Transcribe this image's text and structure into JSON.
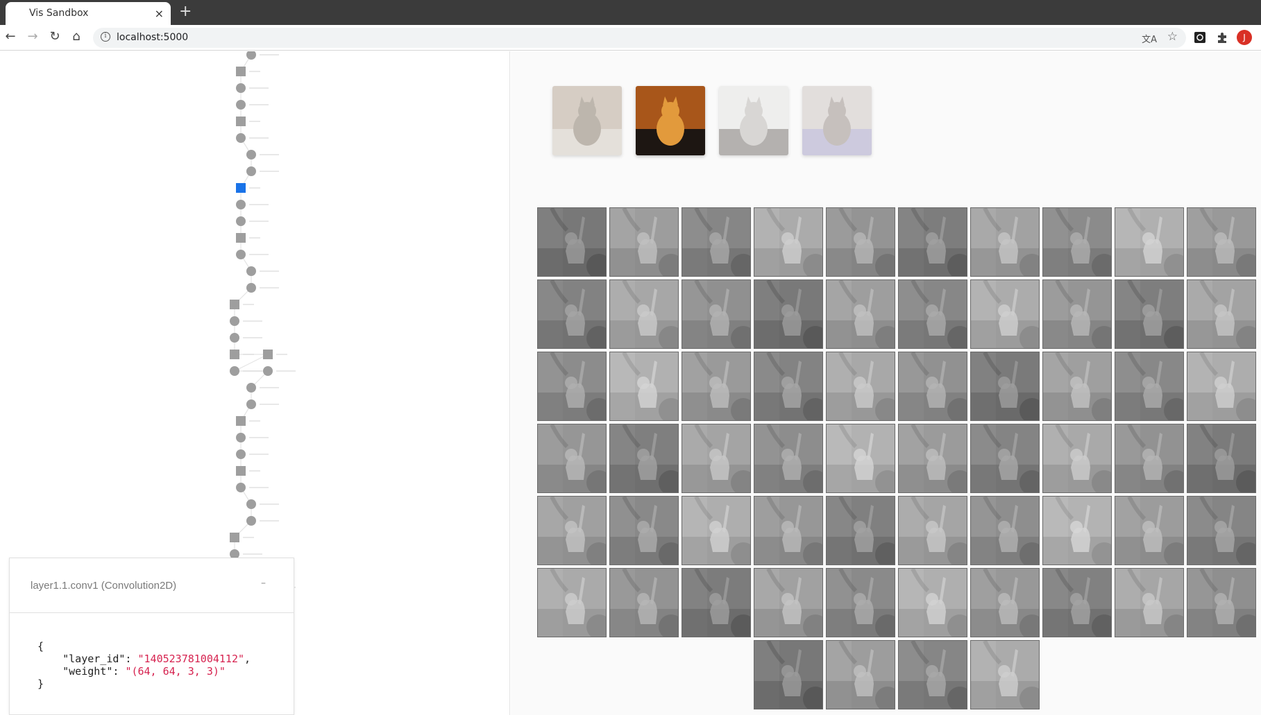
{
  "browser": {
    "tab_title": "Vis Sandbox",
    "tab_close": "×",
    "new_tab": "+",
    "url": "localhost:5000",
    "avatar_letter": "J"
  },
  "thumbnails": [
    {
      "name": "tabby-cat",
      "selected": false
    },
    {
      "name": "orange-kitten",
      "selected": true
    },
    {
      "name": "white-kitten",
      "selected": false
    },
    {
      "name": "cat-in-cage",
      "selected": false
    }
  ],
  "feature_maps": {
    "count": 64,
    "per_row": 10
  },
  "info_card": {
    "title": "layer1.1.conv1 (Convolution2D)",
    "minimize": "–",
    "open_brace": "{",
    "close_brace": "}",
    "layer_id_key": "\"layer_id\": ",
    "layer_id_value": "\"140523781004112\"",
    "weight_key": "\"weight\": ",
    "weight_value": "\"(64, 64, 3, 3)\"",
    "comma": ","
  },
  "colors": {
    "node": "#9e9e9e",
    "selected_node": "#1a73e8",
    "json_string": "#d6224f"
  }
}
